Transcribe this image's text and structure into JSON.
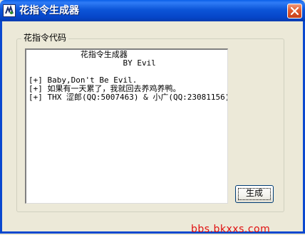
{
  "window": {
    "title": "花指令生成器",
    "app_icon": "app-icon",
    "close_icon": "close-icon"
  },
  "group": {
    "label": "花指令代码"
  },
  "output": {
    "lines": [
      "           花指令生成器",
      "                    BY Evil",
      "",
      "[+] Baby,Don't Be Evil.",
      "[+] 如果有一天累了，我就回去养鸡养鸭。",
      "[+] THX 涩郎(QQ:5007463) & 小广(QQ:23081156)"
    ]
  },
  "buttons": {
    "generate": "生成"
  },
  "watermark": "bbs.bkxxs.com"
}
